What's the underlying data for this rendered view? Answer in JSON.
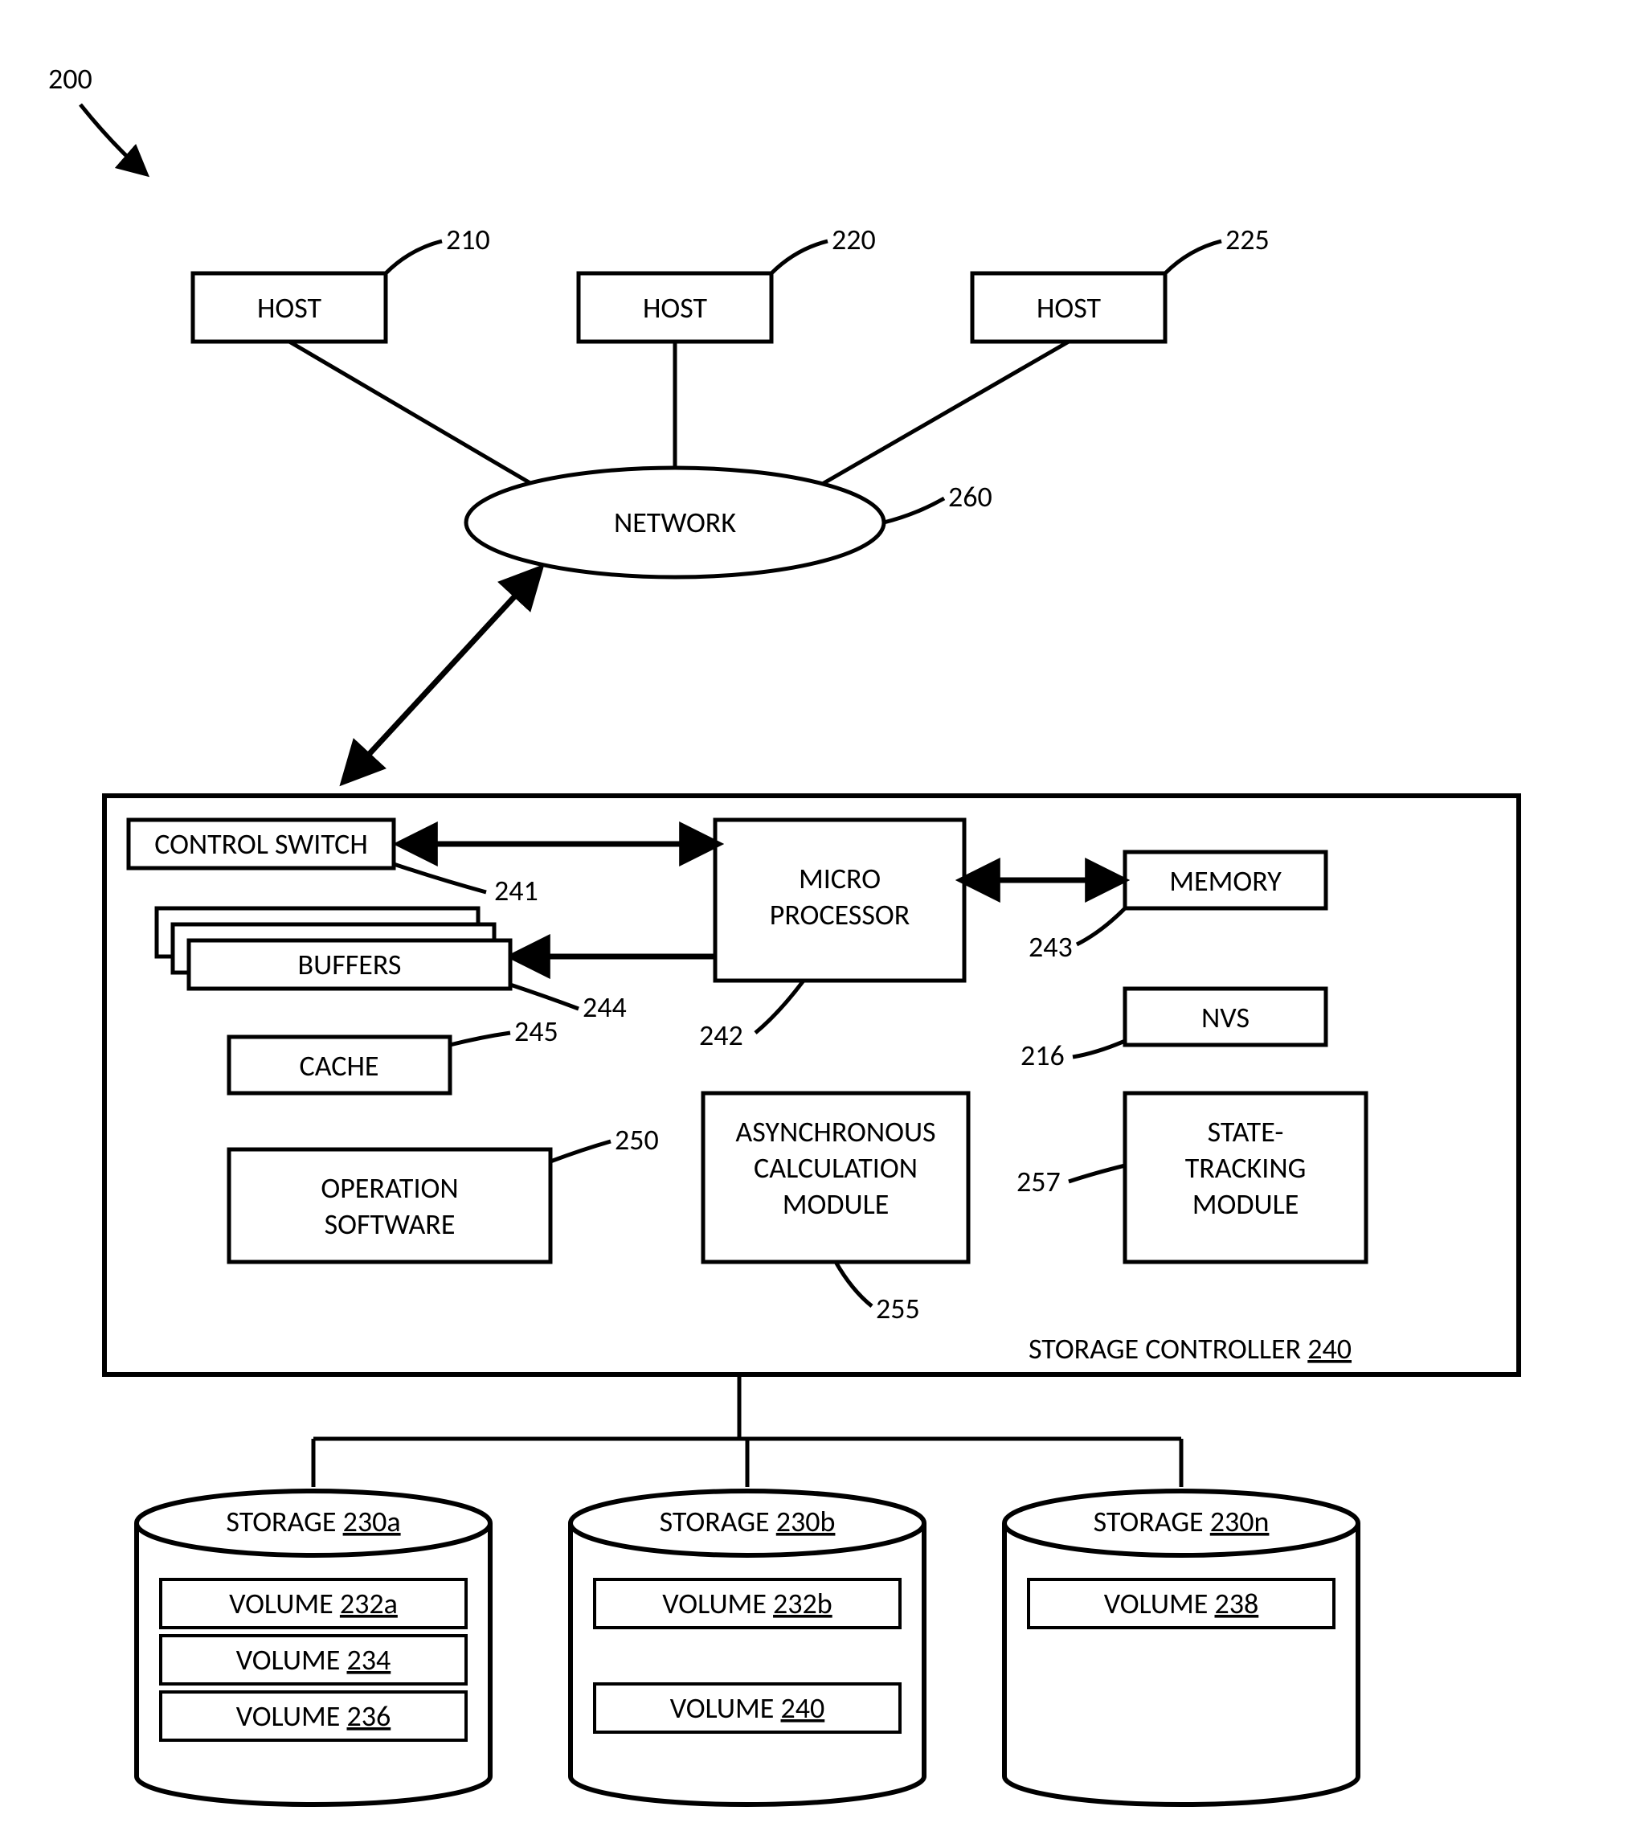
{
  "figure_ref": "200",
  "hosts": [
    {
      "label": "HOST",
      "ref": "210"
    },
    {
      "label": "HOST",
      "ref": "220"
    },
    {
      "label": "HOST",
      "ref": "225"
    }
  ],
  "network": {
    "label": "NETWORK",
    "ref": "260"
  },
  "controller": {
    "title": "STORAGE CONTROLLER",
    "ref": "240",
    "control_switch": {
      "label": "CONTROL SWITCH",
      "ref": "241"
    },
    "micro_processor": {
      "label1": "MICRO",
      "label2": "PROCESSOR",
      "ref": "242"
    },
    "memory": {
      "label": "MEMORY",
      "ref": "243"
    },
    "buffers": {
      "label": "BUFFERS",
      "ref": "244"
    },
    "cache": {
      "label": "CACHE",
      "ref": "245"
    },
    "nvs": {
      "label": "NVS",
      "ref": "216"
    },
    "op_sw": {
      "label1": "OPERATION",
      "label2": "SOFTWARE",
      "ref": "250"
    },
    "async": {
      "label1": "ASYNCHRONOUS",
      "label2": "CALCULATION",
      "label3": "MODULE",
      "ref": "255"
    },
    "state": {
      "label1": "STATE-",
      "label2": "TRACKING",
      "label3": "MODULE",
      "ref": "257"
    }
  },
  "storages": [
    {
      "label": "STORAGE",
      "ref": "230a",
      "volumes": [
        {
          "label": "VOLUME",
          "ref": "232a"
        },
        {
          "label": "VOLUME",
          "ref": "234"
        },
        {
          "label": "VOLUME",
          "ref": "236"
        }
      ]
    },
    {
      "label": "STORAGE",
      "ref": "230b",
      "volumes": [
        {
          "label": "VOLUME",
          "ref": "232b"
        },
        {
          "label": "VOLUME",
          "ref": "240"
        }
      ]
    },
    {
      "label": "STORAGE",
      "ref": "230n",
      "volumes": [
        {
          "label": "VOLUME",
          "ref": "238"
        }
      ]
    }
  ]
}
